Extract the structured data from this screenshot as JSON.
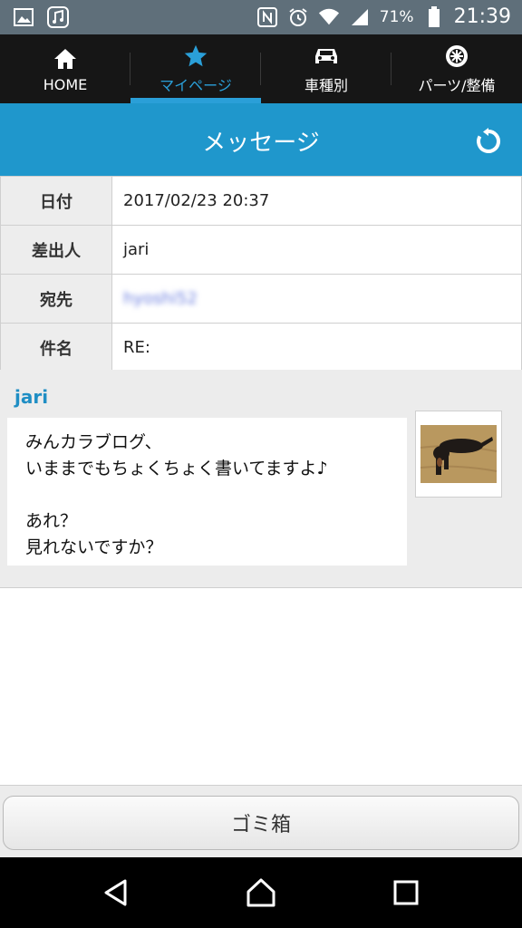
{
  "status_bar": {
    "battery_pct": "71%",
    "time": "21:39",
    "icons": [
      "image-icon",
      "music-icon",
      "nfc-icon",
      "alarm-icon",
      "wifi-icon",
      "signal-icon",
      "battery-icon"
    ]
  },
  "nav": {
    "items": [
      {
        "label": "HOME",
        "icon": "home-icon",
        "active": false
      },
      {
        "label": "マイページ",
        "icon": "star-icon",
        "active": true
      },
      {
        "label": "車種別",
        "icon": "car-icon",
        "active": false
      },
      {
        "label": "パーツ/整備",
        "icon": "wheel-icon",
        "active": false
      }
    ]
  },
  "title": "メッセージ",
  "info": {
    "date_label": "日付",
    "date_value": "2017/02/23 20:37",
    "sender_label": "差出人",
    "sender_value": "jari",
    "to_label": "宛先",
    "to_value": "hyoshi52",
    "subject_label": "件名",
    "subject_value": "RE:"
  },
  "message": {
    "sender": "jari",
    "lines": [
      "みんカラブログ、",
      "いままでもちょくちょく書いてますよ♪",
      "",
      "あれ？",
      "見れないですか？"
    ]
  },
  "trash_label": "ゴミ箱",
  "colors": {
    "accent": "#1f97cc",
    "nav_bg": "#161616",
    "status_bg": "#5f6f7a"
  }
}
